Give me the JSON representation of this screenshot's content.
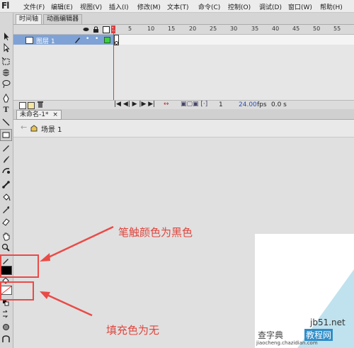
{
  "app": {
    "logo": "Fl"
  },
  "menu": [
    "文件(F)",
    "编辑(E)",
    "视图(V)",
    "插入(I)",
    "修改(M)",
    "文本(T)",
    "命令(C)",
    "控制(O)",
    "调试(D)",
    "窗口(W)",
    "帮助(H)"
  ],
  "panel_tabs": [
    "时间轴",
    "动画编辑器"
  ],
  "timeline": {
    "ticks": [
      "1",
      "5",
      "10",
      "15",
      "20",
      "25",
      "30",
      "35",
      "40",
      "45",
      "50",
      "55"
    ],
    "layer_name": "图层 1",
    "current_frame": "1",
    "frame_rate": "24.00",
    "fps_label": "fps",
    "elapsed": "0.0 s"
  },
  "document": {
    "tab_title": "未命名-1*",
    "scene": "场景 1"
  },
  "annotations": {
    "stroke_note": "笔触颜色为黑色",
    "fill_note": "填充色为无",
    "color": "#e94b47"
  },
  "watermark": {
    "site": "jb51.net",
    "text1": "查字典",
    "text2": "教程网",
    "url": "jiaocheng.chazidian.com"
  },
  "icons": [
    "arrow-select-icon",
    "subselect-icon",
    "free-transform-icon",
    "3d-rotation-icon",
    "lasso-icon",
    "pen-icon",
    "text-icon",
    "line-icon",
    "rectangle-icon",
    "pencil-icon",
    "brush-icon",
    "deco-icon",
    "bone-icon",
    "paint-bucket-icon",
    "eyedropper-icon",
    "eraser-icon",
    "hand-icon",
    "zoom-icon"
  ]
}
